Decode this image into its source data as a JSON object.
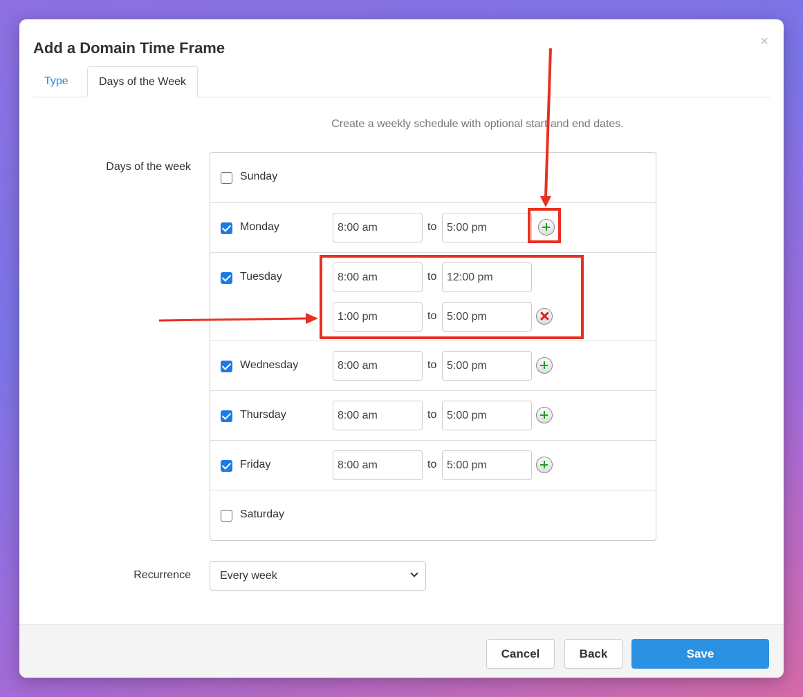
{
  "modal": {
    "title": "Add a Domain Time Frame",
    "close_label": "×"
  },
  "tabs": [
    {
      "label": "Type"
    },
    {
      "label": "Days of the Week"
    }
  ],
  "description": "Create a weekly schedule with optional start and end dates.",
  "days_label": "Days of the week",
  "to_label": "to",
  "days": [
    {
      "name": "Sunday",
      "checked": false
    },
    {
      "name": "Monday",
      "checked": true,
      "start": "8:00 am",
      "end": "5:00 pm"
    },
    {
      "name": "Tuesday",
      "checked": true,
      "start": "8:00 am",
      "end": "12:00 pm",
      "start2": "1:00 pm",
      "end2": "5:00 pm"
    },
    {
      "name": "Wednesday",
      "checked": true,
      "start": "8:00 am",
      "end": "5:00 pm"
    },
    {
      "name": "Thursday",
      "checked": true,
      "start": "8:00 am",
      "end": "5:00 pm"
    },
    {
      "name": "Friday",
      "checked": true,
      "start": "8:00 am",
      "end": "5:00 pm"
    },
    {
      "name": "Saturday",
      "checked": false
    }
  ],
  "recurrence": {
    "label": "Recurrence",
    "value": "Every week"
  },
  "footer": {
    "cancel_label": "Cancel",
    "back_label": "Back",
    "save_label": "Save"
  },
  "colors": {
    "accent": "#2b91e3",
    "annotation": "#e8301f",
    "add_icon": "#1ea01e",
    "remove_icon": "#e02020"
  }
}
